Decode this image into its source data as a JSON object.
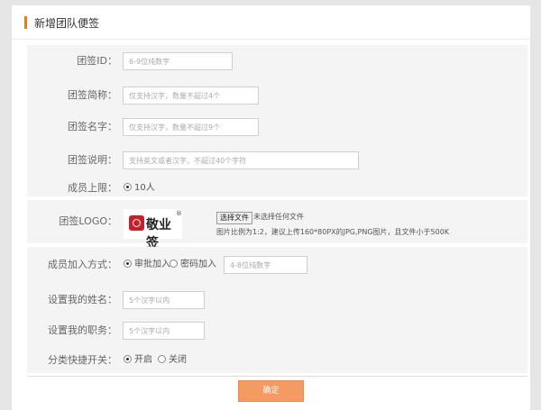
{
  "header": {
    "title": "新增团队便签"
  },
  "basic": {
    "team_id": {
      "label": "团签ID：",
      "placeholder": "6-9位纯数字"
    },
    "short_name": {
      "label": "团签简称：",
      "placeholder": "仅支持汉字，数量不超过4个"
    },
    "name": {
      "label": "团签名字：",
      "placeholder": "仅支持汉字，数量不超过9个"
    },
    "description": {
      "label": "团签说明：",
      "placeholder": "支持英文或者汉字，不超过40个字符"
    },
    "member_limit": {
      "label": "成员上限：",
      "option": "10人"
    }
  },
  "logo": {
    "label": "团签LOGO：",
    "logo_text": "敬业签",
    "logo_mark": "®",
    "file_button": "选择文件",
    "file_status": "未选择任何文件",
    "hint": "图片比例为1:2，建议上传160*80PX的JPG,PNG图片，且文件小于500K"
  },
  "join": {
    "method": {
      "label": "成员加入方式：",
      "option_approval": "审批加入",
      "option_password": "密码加入",
      "password_placeholder": "4-8位纯数字"
    },
    "my_name": {
      "label": "设置我的姓名：",
      "placeholder": "5个汉字以内"
    },
    "my_role": {
      "label": "设置我的职务：",
      "placeholder": "5个汉字以内"
    },
    "shortcut": {
      "label": "分类快捷开关：",
      "option_on": "开启",
      "option_off": "关闭"
    }
  },
  "actions": {
    "confirm": "确定"
  },
  "colors": {
    "accent": "#f07a1a",
    "button": "#f49a63"
  }
}
